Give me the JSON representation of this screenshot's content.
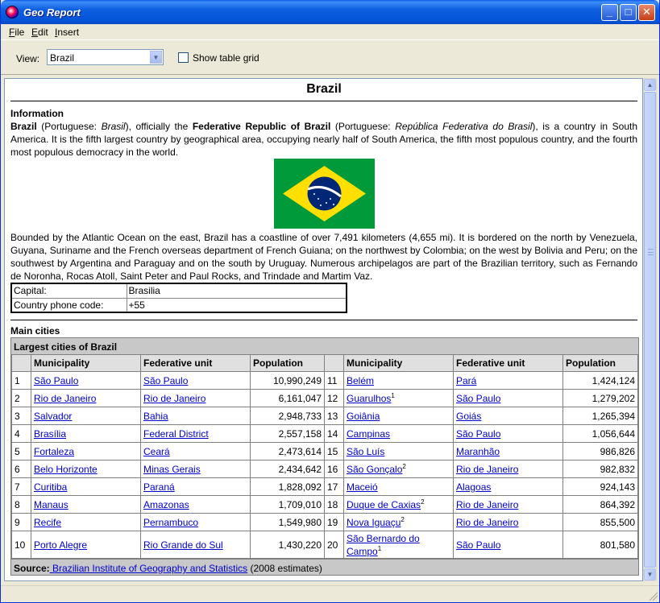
{
  "window": {
    "title": "Geo Report",
    "buttons": {
      "minimize": "_",
      "maximize": "□",
      "close": "✕"
    }
  },
  "menu": [
    {
      "mnemonic": "F",
      "rest": "ile"
    },
    {
      "mnemonic": "E",
      "rest": "dit"
    },
    {
      "mnemonic": "I",
      "rest": "nsert"
    }
  ],
  "toolbar": {
    "view_label": "View:",
    "view_value": "Brazil",
    "show_grid_label": "Show table grid",
    "show_grid_checked": false
  },
  "doc": {
    "title": "Brazil",
    "info_heading": "Information",
    "intro": {
      "b1": "Brazil",
      "t1": " (Portuguese: ",
      "i1": "Brasil",
      "t2": "), officially the ",
      "b2": "Federative Republic of Brazil",
      "t3": " (Portuguese: ",
      "i2": "República Federativa do Brasil",
      "t4": "), is a country in South America. It is the fifth largest country by geographical area, occupying nearly half of South America, the fifth most populous country, and the fourth most populous democracy in the world."
    },
    "geo_paragraph": "Bounded by the Atlantic Ocean on the east, Brazil has a coastline of over 7,491 kilometers (4,655 mi). It is bordered on the north by Venezuela, Guyana, Suriname and the French overseas department of French Guiana; on the northwest by Colombia; on the west by Bolivia and Peru; on the southwest by Argentina and Paraguay and on the south by Uruguay. Numerous archipelagos are part of the Brazilian territory, such as Fernando de Noronha, Rocas Atoll, Saint Peter and Paul Rocks, and Trindade and Martim Vaz.",
    "facts": [
      {
        "key": "Capital:",
        "value": "Brasilia"
      },
      {
        "key": "Country phone code:",
        "value": "+55"
      }
    ],
    "cities_heading": "Main cities",
    "cities_caption": "Largest cities of Brazil",
    "cities_headers": [
      "Municipality",
      "Federative unit",
      "Population"
    ],
    "cities": [
      {
        "rank": "1",
        "city": "São Paulo",
        "sup": "",
        "unit": "São Paulo",
        "pop": "10,990,249"
      },
      {
        "rank": "2",
        "city": "Rio de Janeiro",
        "sup": "",
        "unit": "Rio de Janeiro",
        "pop": "6,161,047"
      },
      {
        "rank": "3",
        "city": "Salvador",
        "sup": "",
        "unit": "Bahia",
        "pop": "2,948,733"
      },
      {
        "rank": "4",
        "city": "Brasília",
        "sup": "",
        "unit": "Federal District",
        "pop": "2,557,158"
      },
      {
        "rank": "5",
        "city": "Fortaleza",
        "sup": "",
        "unit": "Ceará",
        "pop": "2,473,614"
      },
      {
        "rank": "6",
        "city": "Belo Horizonte",
        "sup": "",
        "unit": "Minas Gerais",
        "pop": "2,434,642"
      },
      {
        "rank": "7",
        "city": "Curitiba",
        "sup": "",
        "unit": "Paraná",
        "pop": "1,828,092"
      },
      {
        "rank": "8",
        "city": "Manaus",
        "sup": "",
        "unit": "Amazonas",
        "pop": "1,709,010"
      },
      {
        "rank": "9",
        "city": "Recife",
        "sup": "",
        "unit": "Pernambuco",
        "pop": "1,549,980"
      },
      {
        "rank": "10",
        "city": "Porto Alegre",
        "sup": "",
        "unit": "Rio Grande do Sul",
        "pop": "1,430,220"
      },
      {
        "rank": "11",
        "city": "Belém",
        "sup": "",
        "unit": "Pará",
        "pop": "1,424,124"
      },
      {
        "rank": "12",
        "city": "Guarulhos",
        "sup": "1",
        "unit": "São Paulo",
        "pop": "1,279,202"
      },
      {
        "rank": "13",
        "city": "Goiânia",
        "sup": "",
        "unit": "Goiás",
        "pop": "1,265,394"
      },
      {
        "rank": "14",
        "city": "Campinas",
        "sup": "",
        "unit": "São Paulo",
        "pop": "1,056,644"
      },
      {
        "rank": "15",
        "city": "São Luís",
        "sup": "",
        "unit": "Maranhão",
        "pop": "986,826"
      },
      {
        "rank": "16",
        "city": "São Gonçalo",
        "sup": "2",
        "unit": "Rio de Janeiro",
        "pop": "982,832"
      },
      {
        "rank": "17",
        "city": "Maceió",
        "sup": "",
        "unit": "Alagoas",
        "pop": "924,143"
      },
      {
        "rank": "18",
        "city": "Duque de Caxias",
        "sup": "2",
        "unit": "Rio de Janeiro",
        "pop": "864,392"
      },
      {
        "rank": "19",
        "city": "Nova Iguaçu",
        "sup": "2",
        "unit": "Rio de Janeiro",
        "pop": "855,500"
      },
      {
        "rank": "20",
        "city": "São Bernardo do Campo",
        "sup": "1",
        "unit": "São Paulo",
        "pop": "801,580"
      }
    ],
    "source": {
      "label": "Source:",
      "link": " Brazilian Institute of Geography and Statistics",
      "note": " (2008 estimates)"
    }
  }
}
